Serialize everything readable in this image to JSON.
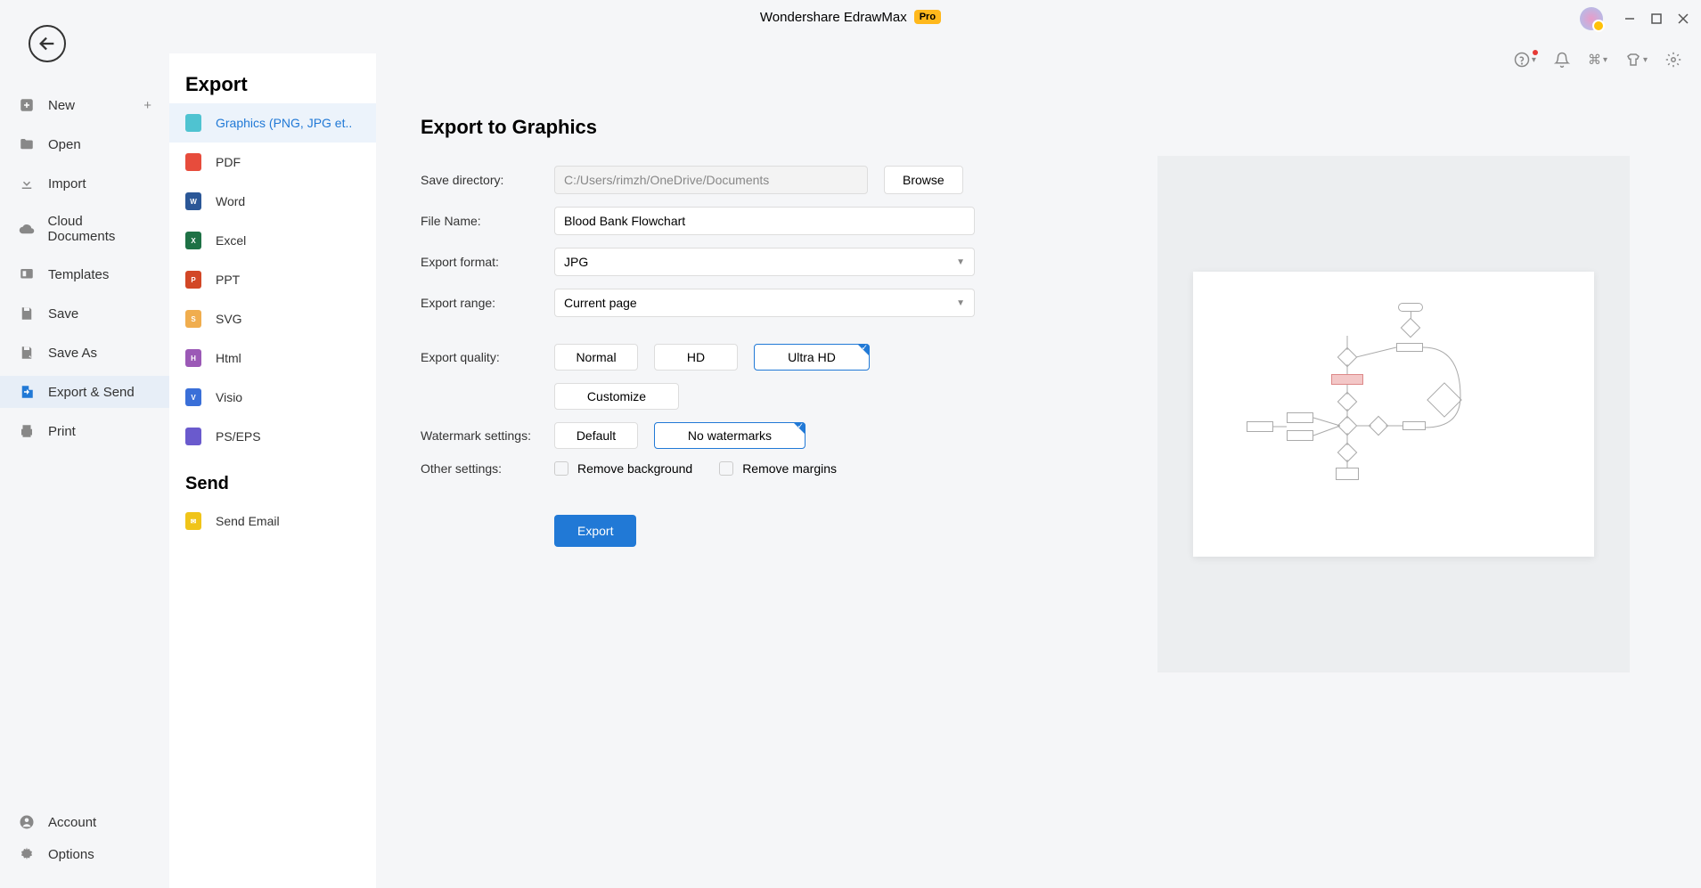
{
  "app": {
    "title": "Wondershare EdrawMax",
    "badge": "Pro"
  },
  "sidebar1": {
    "new": "New",
    "open": "Open",
    "import": "Import",
    "cloud": "Cloud Documents",
    "templates": "Templates",
    "save": "Save",
    "saveas": "Save As",
    "export": "Export & Send",
    "print": "Print",
    "account": "Account",
    "options": "Options"
  },
  "sidebar2": {
    "heading_export": "Export",
    "graphics": "Graphics (PNG, JPG et..",
    "pdf": "PDF",
    "word": "Word",
    "excel": "Excel",
    "ppt": "PPT",
    "svg": "SVG",
    "html": "Html",
    "visio": "Visio",
    "pseps": "PS/EPS",
    "heading_send": "Send",
    "email": "Send Email"
  },
  "form": {
    "title": "Export to Graphics",
    "savedir_lbl": "Save directory:",
    "savedir_val": "C:/Users/rimzh/OneDrive/Documents",
    "browse": "Browse",
    "filename_lbl": "File Name:",
    "filename_val": "Blood Bank Flowchart",
    "format_lbl": "Export format:",
    "format_val": "JPG",
    "range_lbl": "Export range:",
    "range_val": "Current page",
    "quality_lbl": "Export quality:",
    "q_normal": "Normal",
    "q_hd": "HD",
    "q_uhd": "Ultra HD",
    "q_custom": "Customize",
    "wm_lbl": "Watermark settings:",
    "wm_default": "Default",
    "wm_none": "No watermarks",
    "other_lbl": "Other settings:",
    "remove_bg": "Remove background",
    "remove_margins": "Remove margins",
    "export_btn": "Export"
  }
}
